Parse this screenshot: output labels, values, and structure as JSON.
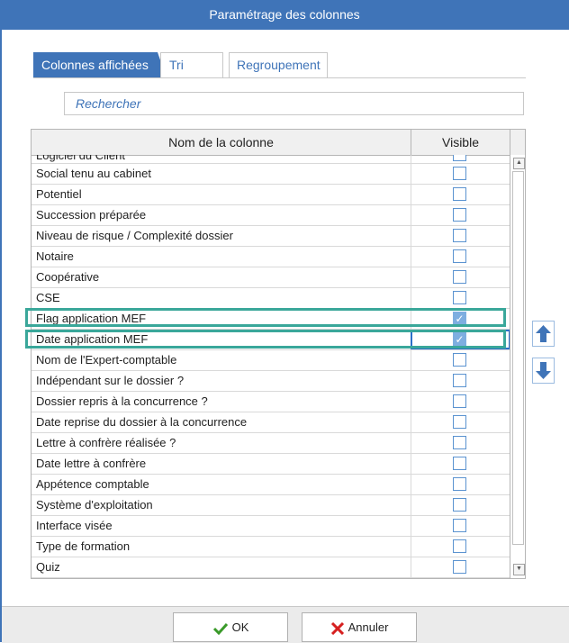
{
  "window": {
    "title": "Paramétrage des colonnes"
  },
  "tabs": [
    {
      "label": "Colonnes affichées",
      "active": true
    },
    {
      "label": "Tri",
      "active": false
    },
    {
      "label": "Regroupement",
      "active": false
    }
  ],
  "search": {
    "placeholder": "Rechercher"
  },
  "grid": {
    "headers": {
      "name": "Nom de la colonne",
      "visible": "Visible"
    },
    "rows": [
      {
        "name": "Logiciel du Client",
        "visible": false
      },
      {
        "name": "Social tenu au cabinet",
        "visible": false
      },
      {
        "name": "Potentiel",
        "visible": false
      },
      {
        "name": "Succession préparée",
        "visible": false
      },
      {
        "name": "Niveau de  risque / Complexité dossier",
        "visible": false
      },
      {
        "name": "Notaire",
        "visible": false
      },
      {
        "name": "Coopérative",
        "visible": false
      },
      {
        "name": "CSE",
        "visible": false
      },
      {
        "name": "Flag application MEF",
        "visible": true
      },
      {
        "name": "Date application MEF",
        "visible": true
      },
      {
        "name": "Nom de l'Expert-comptable",
        "visible": false
      },
      {
        "name": "Indépendant sur le dossier ?",
        "visible": false
      },
      {
        "name": "Dossier repris à la concurrence ?",
        "visible": false
      },
      {
        "name": "Date reprise du dossier à la concurrence",
        "visible": false
      },
      {
        "name": "Lettre à confrère réalisée ?",
        "visible": false
      },
      {
        "name": "Date lettre à confrère",
        "visible": false
      },
      {
        "name": "Appétence comptable",
        "visible": false
      },
      {
        "name": "Système d'exploitation",
        "visible": false
      },
      {
        "name": "Interface visée",
        "visible": false
      },
      {
        "name": "Type de formation",
        "visible": false
      },
      {
        "name": "Quiz",
        "visible": false
      }
    ]
  },
  "footer": {
    "ok_label": "OK",
    "cancel_label": "Annuler"
  },
  "icons": {
    "move_up": "arrow-up-icon",
    "move_down": "arrow-down-icon",
    "ok": "checkmark-icon",
    "cancel": "cross-icon"
  },
  "colors": {
    "accent": "#3f74b8",
    "highlight": "#3aa79a",
    "ok_green": "#3a9a2a",
    "cancel_red": "#d62020"
  }
}
